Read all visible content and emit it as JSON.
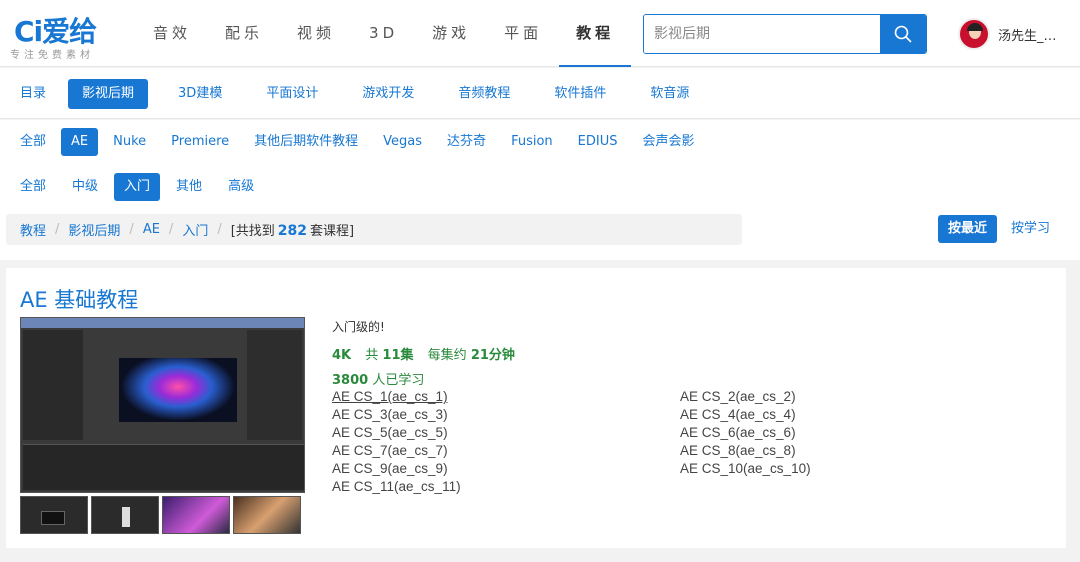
{
  "logo": {
    "mark": "Ci爱给",
    "tagline": "专注免费素材"
  },
  "nav": [
    "音效",
    "配乐",
    "视频",
    "3D",
    "游戏",
    "平面",
    "教程"
  ],
  "nav_active": "教程",
  "search": {
    "placeholder": "影视后期"
  },
  "user": {
    "name": "汤先生_…"
  },
  "categories": [
    "目录",
    "影视后期",
    "3D建模",
    "平面设计",
    "游戏开发",
    "音频教程",
    "软件插件",
    "软音源"
  ],
  "software": [
    "全部",
    "AE",
    "Nuke",
    "Premiere",
    "其他后期软件教程",
    "Vegas",
    "达芬奇",
    "Fusion",
    "EDIUS",
    "会声会影"
  ],
  "levels": [
    "全部",
    "中级",
    "入门",
    "其他",
    "高级"
  ],
  "breadcrumb": {
    "items": [
      "教程",
      "影视后期",
      "AE",
      "入门"
    ],
    "count_prefix": "[共找到",
    "count": "282",
    "count_suffix": "套课程]"
  },
  "sort": {
    "latest": "按最近",
    "study": "按学习"
  },
  "course": {
    "title": "AE 基础教程",
    "desc": "入门级的!",
    "quality": "4K",
    "episodes_prefix": "共",
    "episodes": "11集",
    "per_episode_prefix": "每集约",
    "per_episode": "21分钟",
    "learners_count": "3800",
    "learners_suffix": "人已学习",
    "lessons": [
      "AE CS_1(ae_cs_1)",
      "AE CS_2(ae_cs_2)",
      "AE CS_3(ae_cs_3)",
      "AE CS_4(ae_cs_4)",
      "AE CS_5(ae_cs_5)",
      "AE CS_6(ae_cs_6)",
      "AE CS_7(ae_cs_7)",
      "AE CS_8(ae_cs_8)",
      "AE CS_9(ae_cs_9)",
      "AE CS_10(ae_cs_10)",
      "AE CS_11(ae_cs_11)"
    ]
  },
  "colors": {
    "accent": "#1777d2",
    "green": "#2a8a3c"
  }
}
